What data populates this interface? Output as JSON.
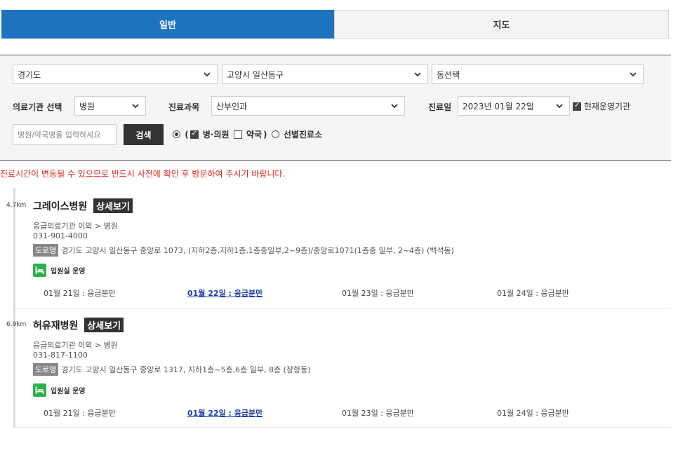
{
  "tabs": [
    {
      "label": "일반",
      "active": true
    },
    {
      "label": "지도",
      "active": false
    }
  ],
  "filters": {
    "province": "경기도",
    "city": "고양시 일산동구",
    "district": "동선택",
    "institution_label": "의료기관 선택",
    "institution_value": "병원",
    "department_label": "진료과목",
    "department_value": "산부인과",
    "date_label": "진료일",
    "date_value": "2023년 01월 22일",
    "current_operating_label": "현재운영기관",
    "current_operating_checked": true,
    "search_placeholder": "병원/약국명을 입력하세요",
    "search_button": "검색",
    "option_hospital": "병·의원",
    "option_pharmacy": "약국",
    "option_screening": "선별진료소",
    "paren_open": "(",
    "paren_close": ")"
  },
  "notice": "진료시간이 변동될 수 있으므로 반드시 사전에 확인 후 방문하여 주시기 바랍니다.",
  "results": [
    {
      "distance": "4.7km",
      "name": "그레이스병원",
      "detail_label": "상세보기",
      "category": "응급의료기관 이외 > 병원",
      "phone": "031-901-4000",
      "road_tag": "도로명",
      "address": "경기도 고양시 일산동구 중앙로 1073, (지하2층,지하1층,1층중일부,2~9층)/중앙로1071(1층중 일부, 2~4층) (백석동)",
      "bed_label": "입원실 운영",
      "days": [
        "01월 21일 : 응급분만",
        "01월 22일 : 응급분만",
        "01월 23일 : 응급분만",
        "01월 24일 : 응급분만"
      ]
    },
    {
      "distance": "6.9km",
      "name": "허유재병원",
      "detail_label": "상세보기",
      "category": "응급의료기관 이외 > 병원",
      "phone": "031-817-1100",
      "road_tag": "도로명",
      "address": "경기도 고양시 일산동구 중앙로 1317, 지하1층~5층,6층 일부, 8층 (장항동)",
      "bed_label": "입원실 운영",
      "days": [
        "01월 21일 : 응급분만",
        "01월 22일 : 응급분만",
        "01월 23일 : 응급분만",
        "01월 24일 : 응급분만"
      ]
    }
  ],
  "colors": {
    "tab_active": "#1e73be",
    "notice": "#e0251c",
    "bed_icon": "#2bb24c",
    "today_link": "#1a3fa8"
  }
}
